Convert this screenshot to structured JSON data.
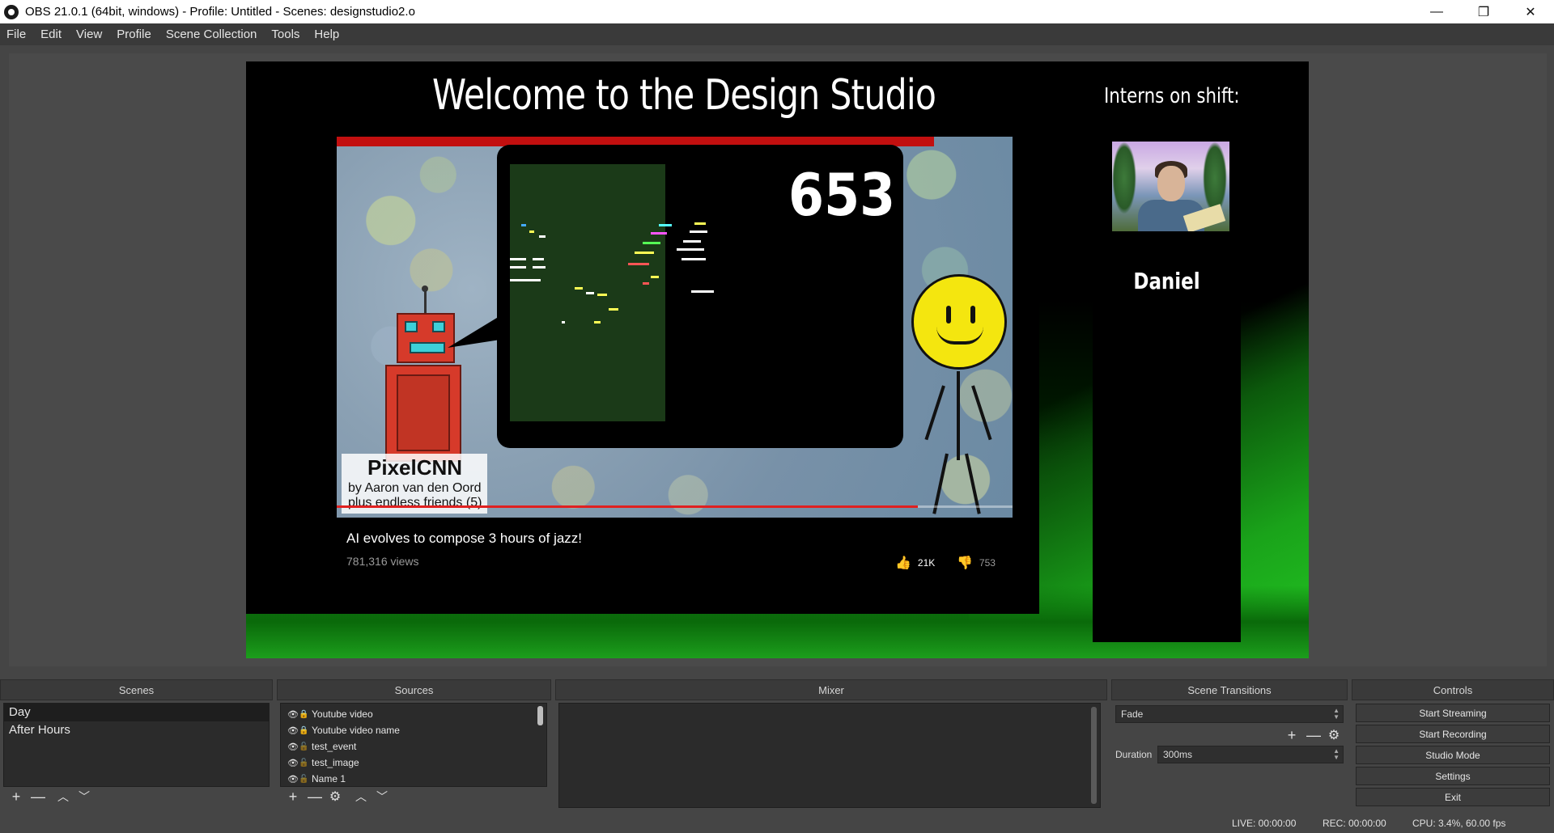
{
  "window": {
    "title": "OBS 21.0.1 (64bit, windows) - Profile: Untitled - Scenes: designstudio2.o",
    "controls": {
      "minimize": "—",
      "restore": "❐",
      "close": "✕"
    }
  },
  "menu": [
    "File",
    "Edit",
    "View",
    "Profile",
    "Scene Collection",
    "Tools",
    "Help"
  ],
  "preview": {
    "heading": "Welcome to the Design Studio",
    "video": {
      "thumbnail_counter": "653",
      "thumbnail_title": "PixelCNN",
      "thumbnail_byline": "by Aaron van den Oord",
      "thumbnail_subline": "plus endless friends (5)",
      "title": "AI evolves to compose 3 hours of jazz!",
      "views": "781,316 views",
      "likes": "21K",
      "dislikes": "753",
      "progress_percent": 86
    },
    "interns": {
      "heading": "Interns on shift:",
      "name": "Daniel"
    }
  },
  "docks": {
    "scenes": {
      "title": "Scenes",
      "items": [
        {
          "label": "Day",
          "selected": true
        },
        {
          "label": "After Hours",
          "selected": false
        }
      ],
      "toolbar": [
        "+",
        "—",
        "︿",
        "﹀"
      ]
    },
    "sources": {
      "title": "Sources",
      "items": [
        {
          "label": "Youtube video",
          "locked": true
        },
        {
          "label": "Youtube video name",
          "locked": true
        },
        {
          "label": "test_event",
          "locked": false
        },
        {
          "label": "test_image",
          "locked": false
        },
        {
          "label": "Name 1",
          "locked": false
        }
      ],
      "toolbar": [
        "+",
        "—",
        "⚙",
        "︿",
        "﹀"
      ]
    },
    "mixer": {
      "title": "Mixer"
    },
    "transitions": {
      "title": "Scene Transitions",
      "selected": "Fade",
      "duration_label": "Duration",
      "duration_value": "300ms",
      "toolbar": [
        "+",
        "—",
        "⚙"
      ]
    },
    "controls": {
      "title": "Controls",
      "buttons": [
        "Start Streaming",
        "Start Recording",
        "Studio Mode",
        "Settings",
        "Exit"
      ]
    }
  },
  "status": {
    "live": "LIVE: 00:00:00",
    "rec": "REC: 00:00:00",
    "cpu": "CPU: 3.4%, 60.00 fps"
  },
  "colors": {
    "accent_red": "#c20f0f",
    "green": "#1aa31a",
    "panel": "#2b2b2b",
    "chrome": "#3a3a3a"
  }
}
